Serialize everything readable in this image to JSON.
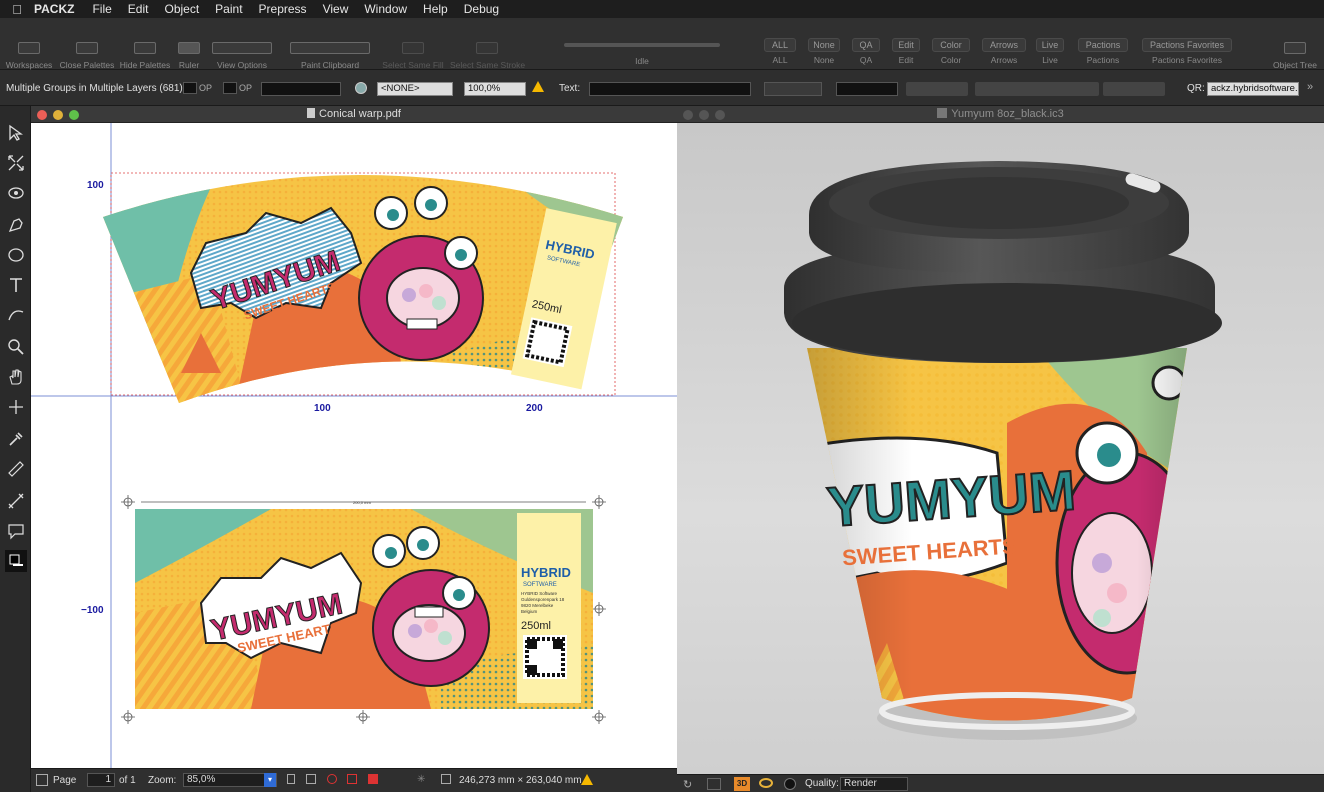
{
  "menubar": {
    "app": "PACKZ",
    "items": [
      "File",
      "Edit",
      "Object",
      "Paint",
      "Prepress",
      "View",
      "Window",
      "Help",
      "Debug"
    ]
  },
  "toolbar": {
    "workspaces": "Workspaces",
    "close_palettes": "Close Palettes",
    "hide_palettes": "Hide Palettes",
    "ruler": "Ruler",
    "view_options": "View Options",
    "paint_clipboard": "Paint Clipboard",
    "select_same_fill": "Select Same Fill",
    "select_same_stroke": "Select Same Stroke",
    "idle": "Idle",
    "segments": [
      {
        "top": "ALL",
        "label": "ALL"
      },
      {
        "top": "None",
        "label": "None"
      },
      {
        "top": "QA",
        "label": "QA"
      },
      {
        "top": "Edit",
        "label": "Edit"
      },
      {
        "top": "Color",
        "label": "Color"
      },
      {
        "top": "Arrows",
        "label": "Arrows"
      },
      {
        "top": "Live",
        "label": "Live"
      },
      {
        "top": "Pactions",
        "label": "Pactions"
      },
      {
        "top": "Pactions Favorites",
        "label": "Pactions Favorites"
      }
    ],
    "object_tree": "Object Tree"
  },
  "props": {
    "selection": "Multiple Groups in Multiple Layers (681)",
    "op1": "OP",
    "op2": "OP",
    "swatch": "<NONE>",
    "opacity": "100,0%",
    "text_label": "Text:",
    "qr_label": "QR:",
    "qr_value": "ackz.hybridsoftware.c"
  },
  "left_window": {
    "title": "Conical warp.pdf",
    "ruler": {
      "x_100": "100",
      "x_200": "200",
      "y_100": "100",
      "y_neg100": "−100"
    },
    "dimension_label": "200,0 mm"
  },
  "artwork": {
    "brand": "YUMYUM",
    "tagline": "SWEET HEARTS",
    "logo": "HYBRID",
    "logo_sub": "SOFTWARE",
    "address": [
      "HYBRID Software",
      "Guldensporenpark 18",
      "9820 Merelbeke",
      "Belgium"
    ],
    "volume": "250ml"
  },
  "status_left": {
    "page_label": "Page",
    "page_value": "1",
    "of_label": "of 1",
    "zoom_label": "Zoom:",
    "zoom_value": "85,0%",
    "size": "246,273 mm × 263,040 mm"
  },
  "right_window": {
    "title": "Yumyum 8oz_black.ic3"
  },
  "status_right": {
    "quality_label": "Quality:",
    "quality_value": "Render",
    "mode_3d": "3D"
  },
  "colors": {
    "bg_dark": "#2b2b2b",
    "ruler_blue": "#1a1aa0",
    "pink": "#c42b6e",
    "teal": "#2a8c8c",
    "orange": "#e8703a",
    "yellow": "#f6c445",
    "green": "#9ec690",
    "warning": "#f5b800"
  }
}
